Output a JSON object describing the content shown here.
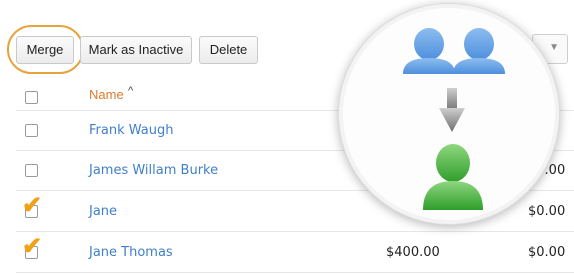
{
  "toolbar": {
    "merge_label": "Merge",
    "mark_inactive_label": "Mark as Inactive",
    "delete_label": "Delete"
  },
  "table": {
    "header": {
      "name_label": "Name",
      "sort_indicator": "^"
    },
    "rows": [
      {
        "name": "Frank Waugh",
        "checked": false,
        "amount_1": "",
        "amount_2": ""
      },
      {
        "name": "James Willam Burke",
        "checked": false,
        "amount_1": "",
        "amount_2": "$0.00"
      },
      {
        "name": "Jane",
        "checked": true,
        "amount_1": "$",
        "amount_2": "$0.00"
      },
      {
        "name": "Jane Thomas",
        "checked": true,
        "amount_1": "$400.00",
        "amount_2": "$0.00"
      }
    ]
  },
  "overlay": {
    "icons": [
      "user-icon",
      "user-icon",
      "arrow-down-icon",
      "merged-user-icon"
    ],
    "colors": {
      "source_users": "#5b9be0",
      "merged_user": "#3fae3a",
      "arrow": "#7a7a7a",
      "highlight_ring": "#e8a23a",
      "link": "#3f7fc9"
    }
  }
}
